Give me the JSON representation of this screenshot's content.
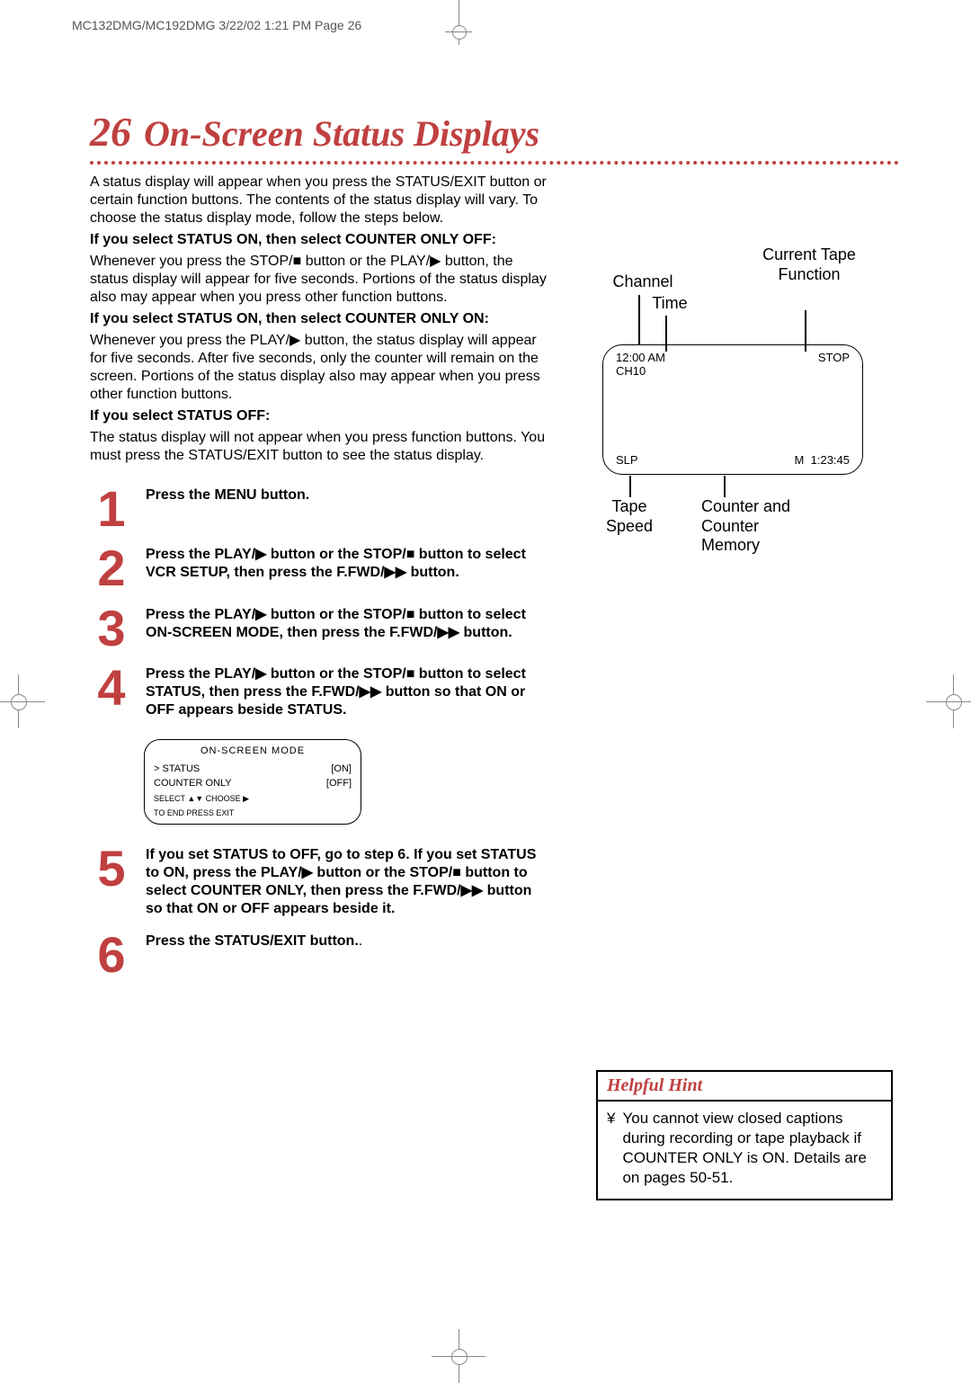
{
  "crop_header": "MC132DMG/MC192DMG  3/22/02  1:21 PM  Page 26",
  "title": {
    "num": "26",
    "text": "On-Screen Status Displays"
  },
  "intro": {
    "p1": "A status display will appear when you press the STATUS/EXIT button or certain function buttons. The contents of the status display will vary.  To choose the status display mode, follow the steps below.",
    "h1": "If you select STATUS ON, then select COUNTER ONLY OFF:",
    "p2": "Whenever you press the STOP/■ button or the PLAY/▶ button, the status display will appear for five seconds. Portions of the status display also may appear when you press other function buttons.",
    "h2": "If you select STATUS ON, then select COUNTER ONLY ON:",
    "p3": "Whenever you press the PLAY/▶ button, the status display will appear for five seconds. After five seconds, only the counter will remain on the screen. Portions of the status display also may appear when you press other function buttons.",
    "h3": "If you select STATUS OFF:",
    "p4": "The status display will not appear when you press function buttons. You must press the STATUS/EXIT button to see the status display."
  },
  "steps": [
    {
      "n": "1",
      "t": "Press the MENU button."
    },
    {
      "n": "2",
      "t": "Press the PLAY/▶ button or the STOP/■ button to select VCR SETUP, then press the F.FWD/▶▶ button."
    },
    {
      "n": "3",
      "t": "Press the PLAY/▶ button or the STOP/■ button to select ON-SCREEN MODE, then press the F.FWD/▶▶ button."
    },
    {
      "n": "4",
      "t": "Press the PLAY/▶ button or the STOP/■ button to select STATUS, then press the F.FWD/▶▶ button so that ON or OFF appears beside STATUS."
    },
    {
      "n": "5",
      "t": "If you set STATUS to OFF, go to step 6. If you set STATUS to ON, press the PLAY/▶ button or the STOP/■ button to select COUNTER ONLY, then press the F.FWD/▶▶ button so that ON or OFF appears beside it."
    },
    {
      "n": "6",
      "t": "Press the STATUS/EXIT button."
    }
  ],
  "menu_box": {
    "title": "ON-SCREEN MODE",
    "rows": [
      {
        "l": ">  STATUS",
        "r": "[ON]"
      },
      {
        "l": "   COUNTER ONLY",
        "r": "[OFF]"
      }
    ],
    "footer1": "SELECT ▲▼   CHOOSE ▶",
    "footer2": "TO  END  PRESS  EXIT"
  },
  "diagram": {
    "channel": "Channel",
    "time": "Time",
    "current_func": "Current Tape Function",
    "tape_speed": "Tape Speed",
    "counter": "Counter and Counter Memory",
    "screen_time": "12:00 AM",
    "screen_ch": "CH10",
    "screen_stop": "STOP",
    "screen_slp": "SLP",
    "screen_m": "M",
    "screen_counter": "1:23:45"
  },
  "hint": {
    "title": "Helpful Hint",
    "bullet_sym": "¥",
    "text": "You cannot view closed captions during recording or tape playback if COUNTER ONLY is ON. Details are on pages 50-51."
  }
}
